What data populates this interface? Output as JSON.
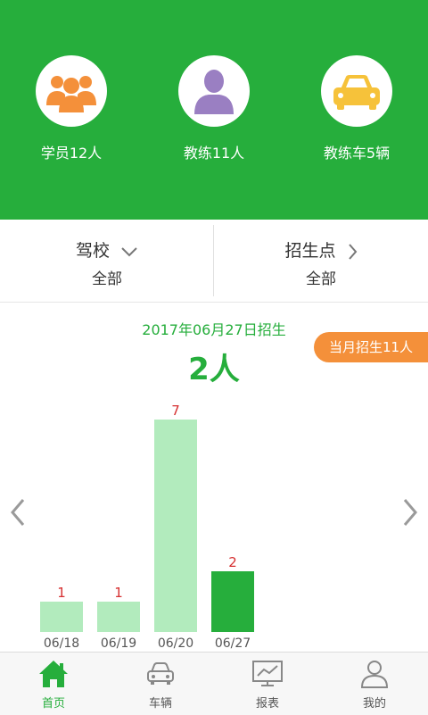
{
  "header": {
    "stats": [
      {
        "label": "学员12人",
        "icon": "students-icon",
        "color": "#f4903a"
      },
      {
        "label": "教练11人",
        "icon": "coach-icon",
        "color": "#9a7fc2"
      },
      {
        "label": "教练车5辆",
        "icon": "car-icon",
        "color": "#f6c23a"
      }
    ]
  },
  "filters": {
    "school_title": "驾校",
    "school_value": "全部",
    "site_title": "招生点",
    "site_value": "全部"
  },
  "stats": {
    "date_title": "2017年06月27日招生",
    "count": "2人",
    "month_badge": "当月招生11人"
  },
  "chart_data": {
    "type": "bar",
    "categories": [
      "06/18",
      "06/19",
      "06/20",
      "06/27"
    ],
    "values": [
      1,
      1,
      7,
      2
    ],
    "highlight_index": 3,
    "colors": {
      "bar": "#b2ebbd",
      "highlight": "#26ae3c",
      "value_label": "#d63031"
    }
  },
  "bottom_nav": [
    {
      "label": "首页",
      "icon": "home-icon",
      "active": true
    },
    {
      "label": "车辆",
      "icon": "car-outline-icon",
      "active": false
    },
    {
      "label": "报表",
      "icon": "report-icon",
      "active": false
    },
    {
      "label": "我的",
      "icon": "profile-icon",
      "active": false
    }
  ],
  "colors": {
    "brand": "#26ae3c",
    "accent": "#f4903a",
    "inactive": "#888888"
  }
}
